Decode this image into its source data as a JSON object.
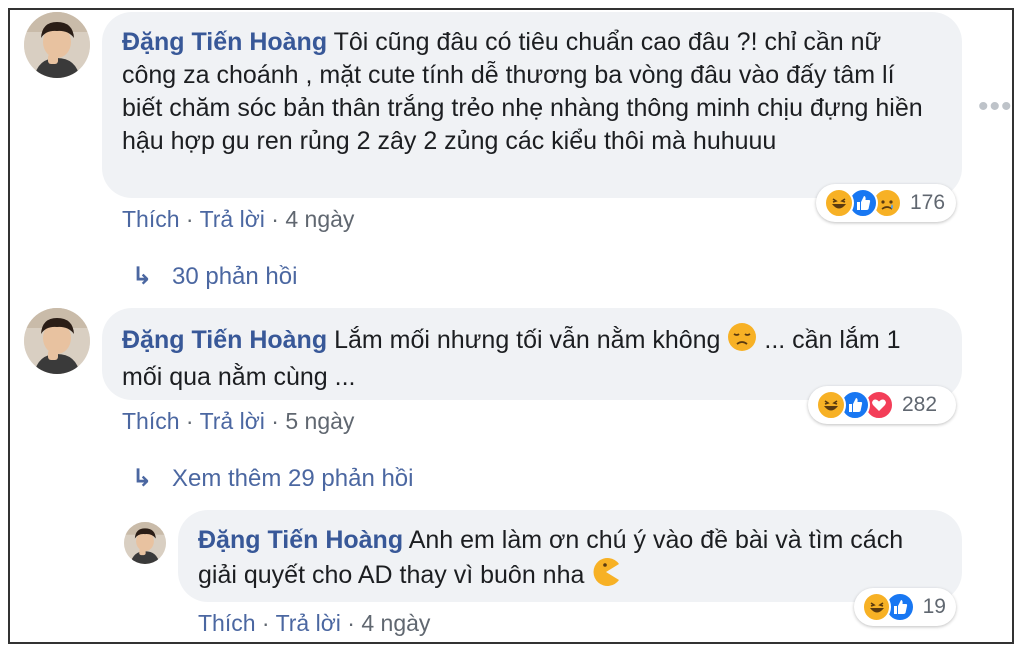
{
  "comments": [
    {
      "author": "Đặng Tiến Hoàng",
      "text": "Tôi cũng đâu có tiêu chuẩn cao đâu ?! chỉ cần nữ công za choánh , mặt cute tính dễ thương ba vòng đâu vào đấy tâm lí biết chăm sóc bản thân trắng trẻo nhẹ nhàng thông minh chịu đựng hiền hậu hợp gu ren rủng 2 zây 2 zủng các kiểu thôi mà huhuuu",
      "like": "Thích",
      "reply": "Trả lời",
      "time": "4 ngày",
      "reactions": [
        "haha",
        "like",
        "sad"
      ],
      "count": "176",
      "replies_link": "30 phản hồi"
    },
    {
      "author": "Đặng Tiến Hoàng",
      "text_before": "Lắm mối nhưng tối vẫn nằm không",
      "text_after": "... cần lắm 1 mối qua nằm cùng ...",
      "like": "Thích",
      "reply": "Trả lời",
      "time": "5 ngày",
      "reactions": [
        "haha",
        "like",
        "love"
      ],
      "count": "282",
      "replies_link": "Xem thêm 29 phản hồi"
    },
    {
      "author": "Đặng Tiến Hoàng",
      "text": "Anh em làm ơn chú ý vào đề bài và tìm cách giải quyết cho AD thay vì buôn nha",
      "like": "Thích",
      "reply": "Trả lời",
      "time": "4 ngày",
      "reactions": [
        "haha",
        "like"
      ],
      "count": "19"
    }
  ],
  "colors": {
    "author": "#385898",
    "link": "#4b67a1",
    "bubble": "#f0f2f5",
    "like": "#1877f2",
    "love": "#f33e58",
    "haha": "#f7b125"
  },
  "icons": {
    "more": "more-options-icon",
    "reply_arrow": "reply-arrow-icon"
  }
}
